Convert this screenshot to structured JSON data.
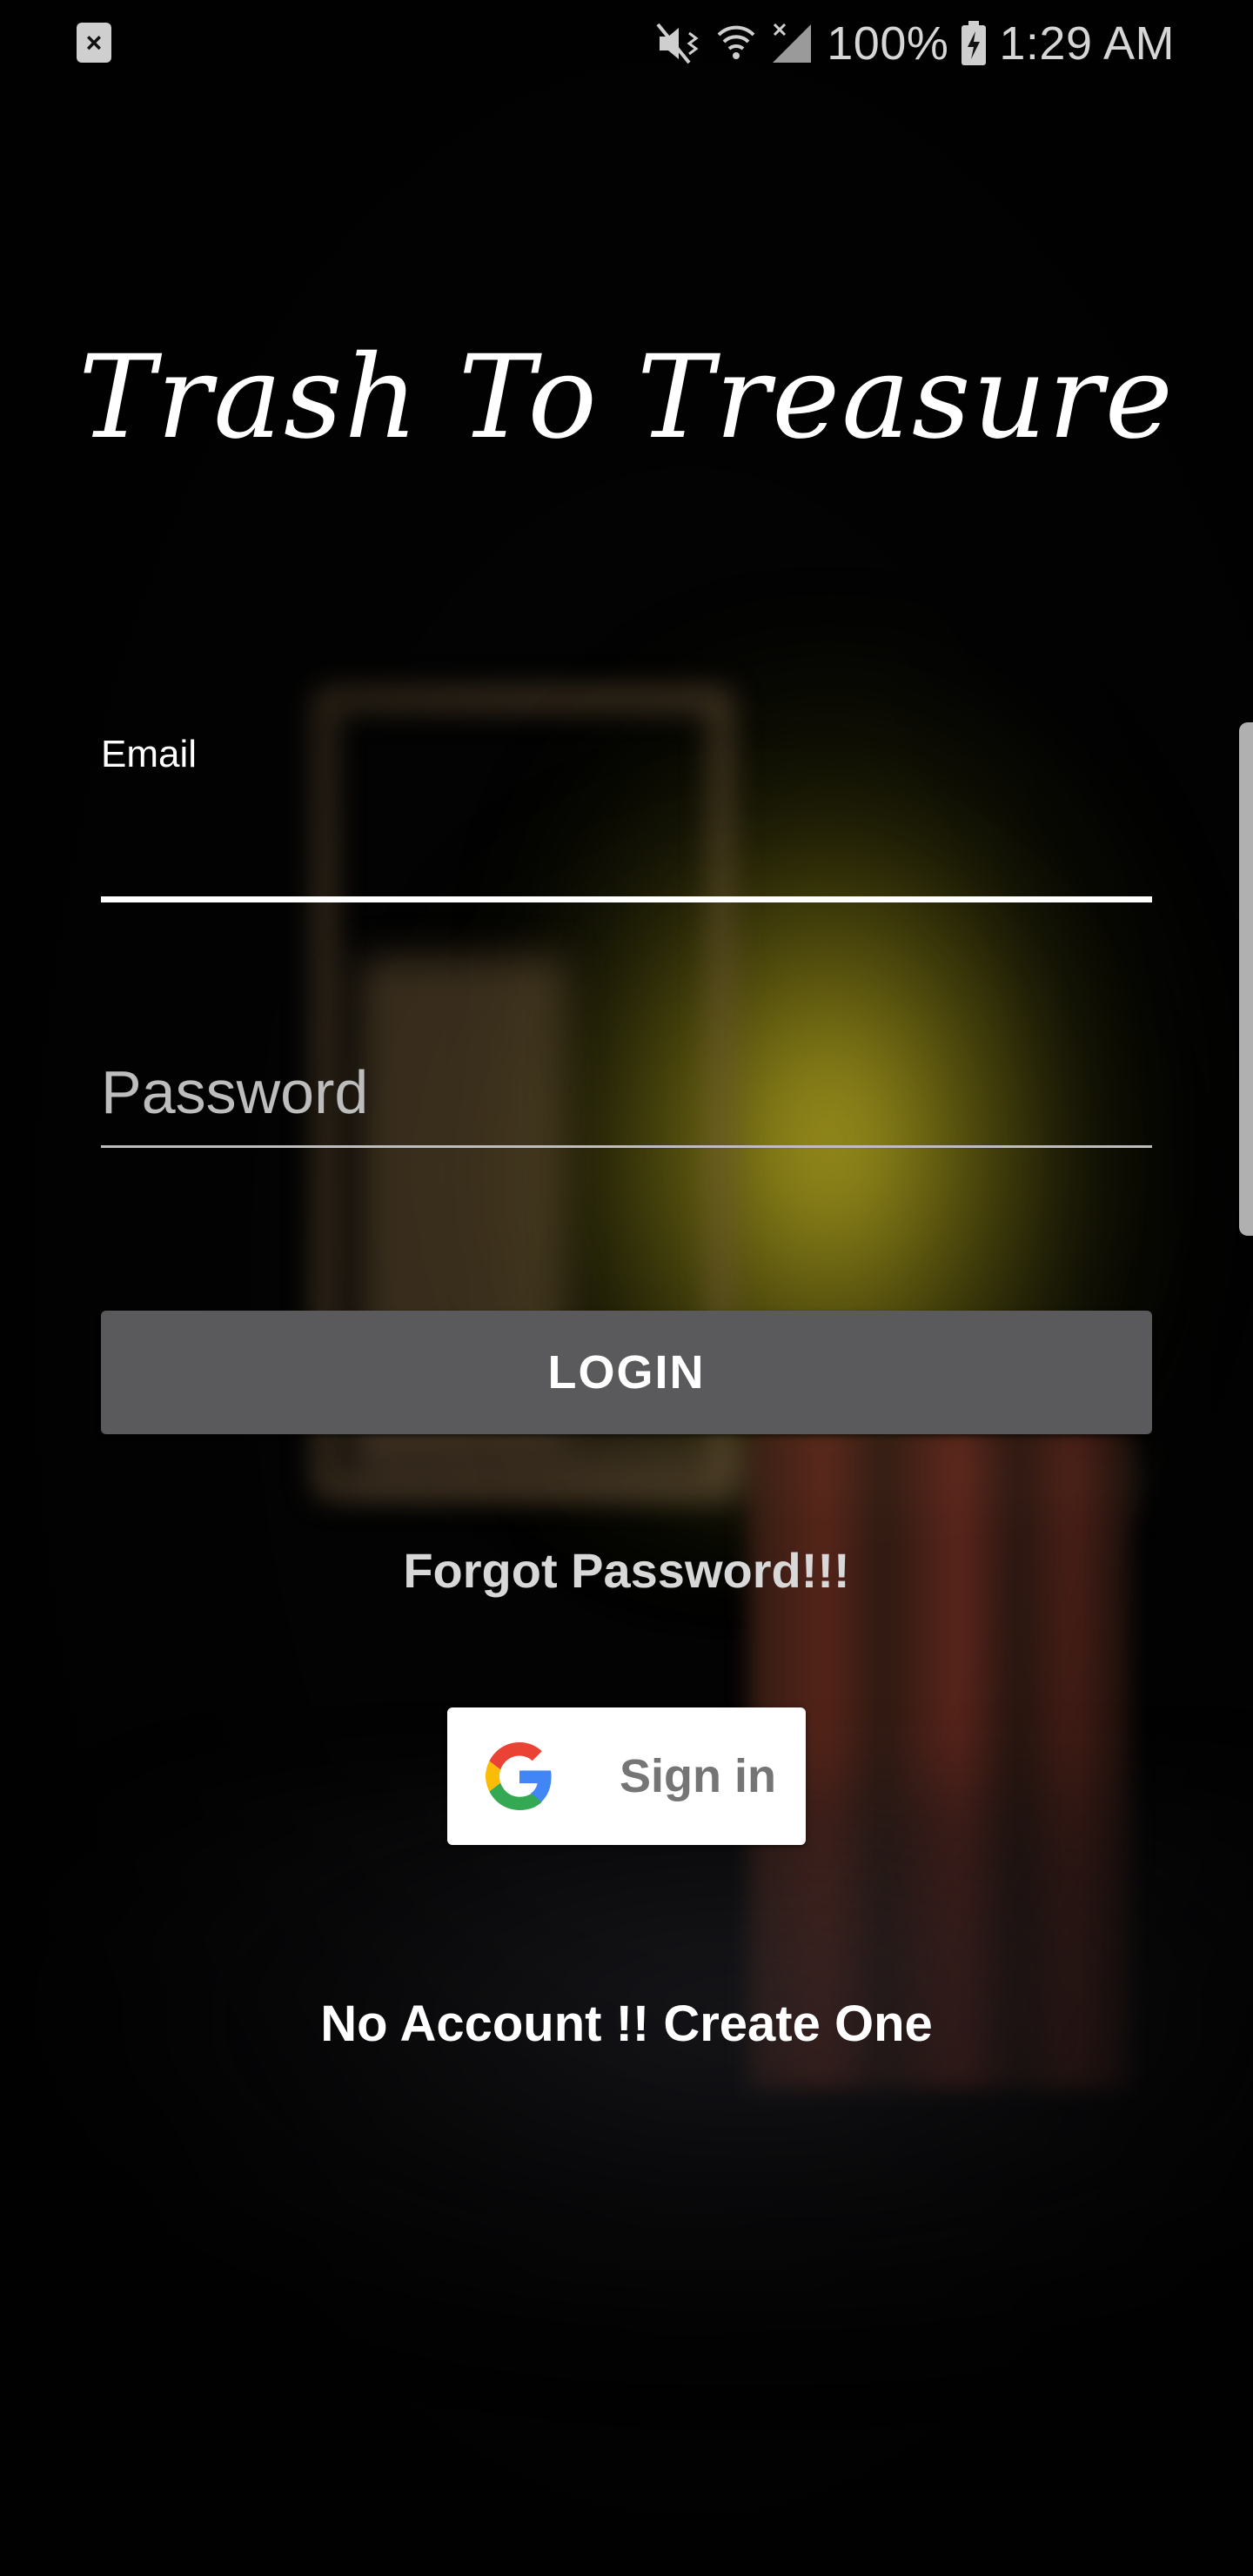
{
  "status_bar": {
    "battery": "100%",
    "time": "1:29 AM",
    "icons": [
      "notification-close-icon",
      "mute-vibrate-icon",
      "wifi-icon",
      "cellular-signal-icon",
      "battery-charging-icon"
    ]
  },
  "app": {
    "title": "Trash To Treasure"
  },
  "form": {
    "email_label": "Email",
    "email_value": "",
    "password_placeholder": "Password",
    "login_label": "LOGIN",
    "forgot_label": "Forgot Password!!!",
    "google_label": "Sign in",
    "create_account_label": "No Account !! Create One"
  },
  "colors": {
    "login_button": "#5a5a5c",
    "accent": "#ffffff"
  }
}
